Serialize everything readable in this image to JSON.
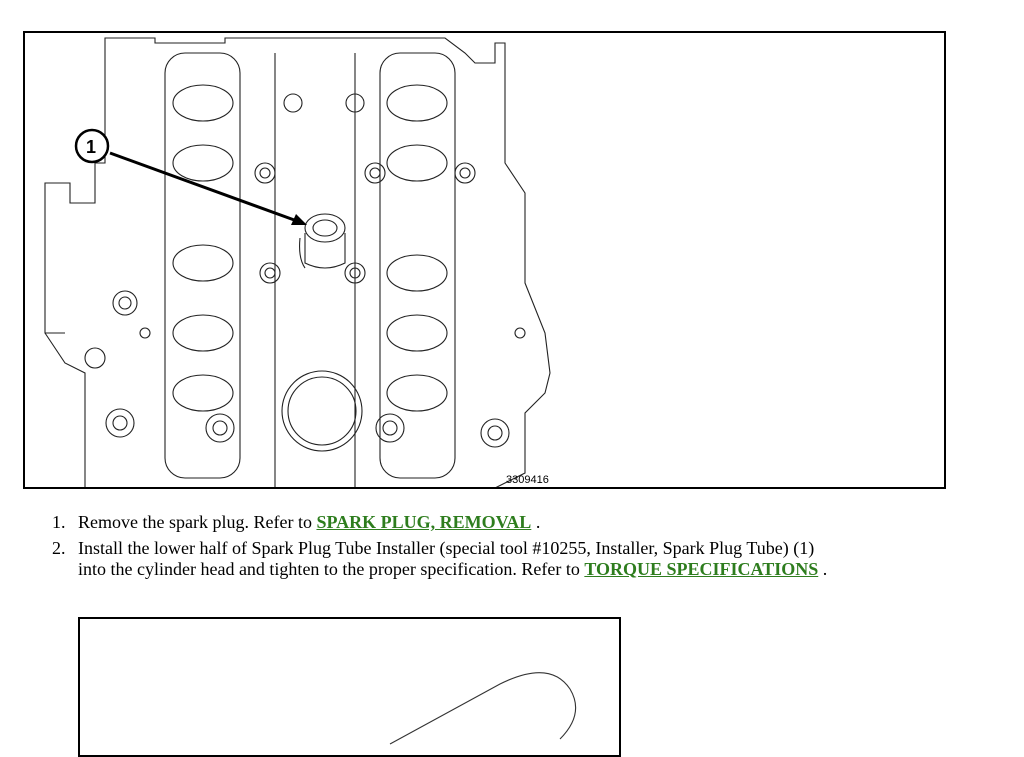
{
  "figure1": {
    "figure_number": "3309416",
    "callout": "1"
  },
  "steps": [
    {
      "number": "1.",
      "text_before": "Remove the spark plug. Refer to ",
      "link": "SPARK PLUG, REMOVAL",
      "text_after": " ."
    },
    {
      "number": "2.",
      "text_line1": "Install the lower half of Spark Plug Tube Installer (special tool #10255, Installer, Spark Plug Tube) (1)",
      "text_line2": "into the cylinder head and tighten to the proper specification. Refer to ",
      "link": "TORQUE SPECIFICATIONS",
      "text_after": " ."
    }
  ],
  "colors": {
    "link": "#2e7d1e",
    "border": "#000000"
  },
  "icons": [
    "engine-illustration",
    "callout-circle",
    "arrow",
    "installer-tool-illustration"
  ]
}
